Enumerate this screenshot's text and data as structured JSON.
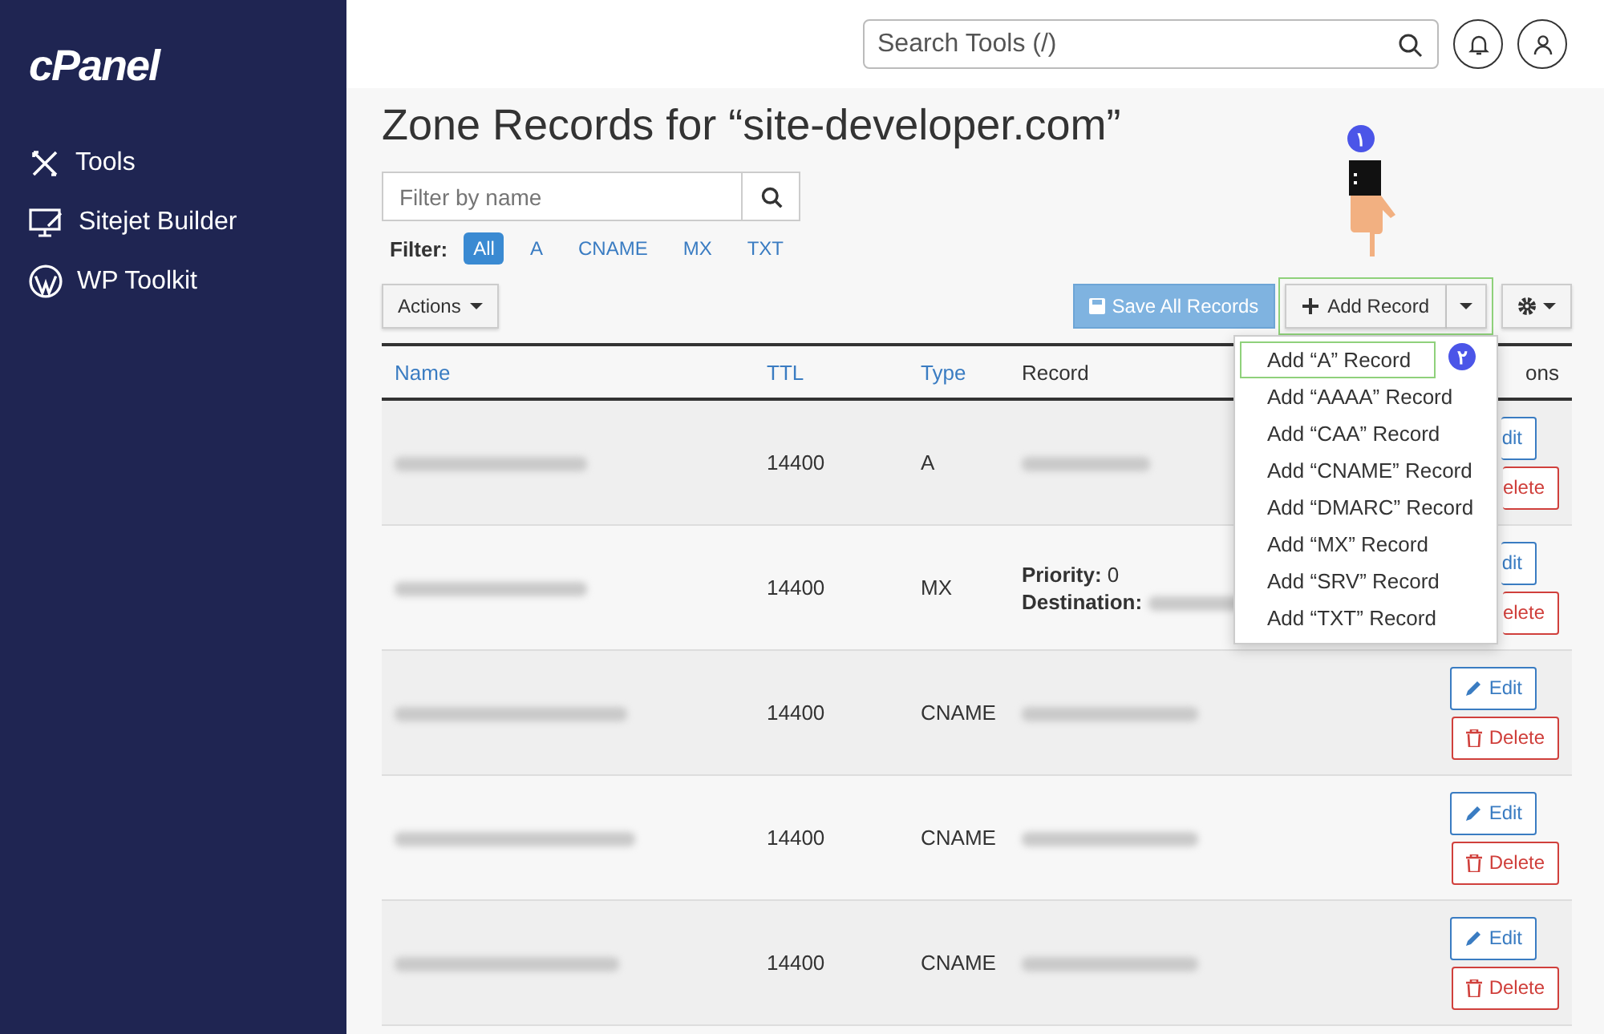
{
  "sidebar": {
    "logo": "cPanel",
    "items": [
      {
        "kind": "tools",
        "label": "Tools"
      },
      {
        "kind": "sitejet",
        "label": "Sitejet Builder"
      },
      {
        "kind": "wordpress",
        "label": "WP Toolkit"
      }
    ]
  },
  "header": {
    "search": {
      "placeholder": "Search Tools (/)"
    }
  },
  "title": "Zone Records for “site-developer.com”",
  "filter_field": {
    "placeholder": "Filter by name"
  },
  "filter": {
    "label": "Filter:",
    "options": [
      {
        "label": "All",
        "selected": true
      },
      {
        "label": "A",
        "selected": false
      },
      {
        "label": "CNAME",
        "selected": false
      },
      {
        "label": "MX",
        "selected": false
      },
      {
        "label": "TXT",
        "selected": false
      }
    ]
  },
  "toolbar": {
    "actions": "Actions",
    "save": "Save All Records",
    "add": "Add Record"
  },
  "table": {
    "columns": [
      "Name",
      "TTL",
      "Type",
      "Record",
      "ons"
    ],
    "rows": [
      {
        "ttl": "14400",
        "type": "A",
        "edit": "dit",
        "delete": "elete",
        "covered": true
      },
      {
        "ttl": "14400",
        "type": "MX",
        "priority_label": "Priority:",
        "priority": "0",
        "destination_label": "Destination:",
        "edit": "dit",
        "delete": "elete",
        "covered": true
      },
      {
        "ttl": "14400",
        "type": "CNAME",
        "edit": "Edit",
        "delete": "Delete",
        "covered": false
      },
      {
        "ttl": "14400",
        "type": "CNAME",
        "edit": "Edit",
        "delete": "Delete",
        "covered": false
      },
      {
        "ttl": "14400",
        "type": "CNAME",
        "edit": "Edit",
        "delete": "Delete",
        "covered": false
      }
    ]
  },
  "dropdown": {
    "items": [
      {
        "label": "Add “A” Record",
        "selected": true
      },
      {
        "label": "Add “AAAA” Record",
        "selected": false
      },
      {
        "label": "Add “CAA” Record",
        "selected": false
      },
      {
        "label": "Add “CNAME” Record",
        "selected": false
      },
      {
        "label": "Add “DMARC” Record",
        "selected": false
      },
      {
        "label": "Add “MX” Record",
        "selected": false
      },
      {
        "label": "Add “SRV” Record",
        "selected": false
      },
      {
        "label": "Add “TXT” Record",
        "selected": false
      }
    ]
  },
  "annotations": [
    {
      "label": "۱"
    },
    {
      "label": "۲"
    }
  ]
}
